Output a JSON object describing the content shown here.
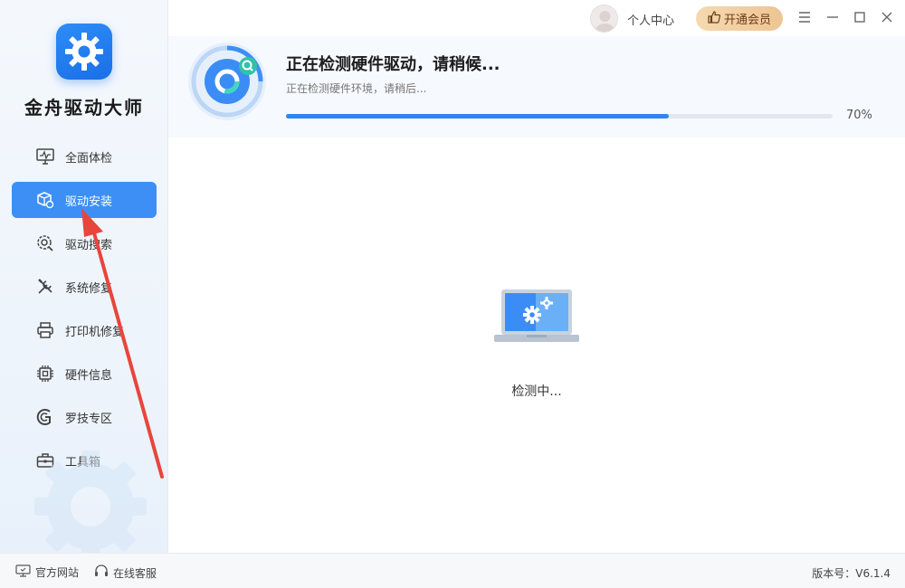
{
  "app": {
    "name": "金舟驱动大师"
  },
  "sidebar": {
    "items": [
      {
        "label": "全面体检",
        "icon": "monitor-check-icon",
        "active": false
      },
      {
        "label": "驱动安装",
        "icon": "package-gear-icon",
        "active": true
      },
      {
        "label": "驱动搜索",
        "icon": "search-gear-icon",
        "active": false
      },
      {
        "label": "系统修复",
        "icon": "wrench-screwdriver-icon",
        "active": false
      },
      {
        "label": "打印机修复",
        "icon": "printer-icon",
        "active": false
      },
      {
        "label": "硬件信息",
        "icon": "chip-icon",
        "active": false
      },
      {
        "label": "罗技专区",
        "icon": "logitech-icon",
        "active": false
      },
      {
        "label": "工具箱",
        "icon": "toolbox-icon",
        "active": false
      }
    ]
  },
  "topbar": {
    "user_center": "个人中心",
    "vip_label": "开通会员"
  },
  "scan": {
    "title": "正在检测硬件驱动，请稍候...",
    "subtitle": "正在检测硬件环境，请稍后...",
    "progress": 0.7,
    "progress_label": "70%"
  },
  "main": {
    "status": "检测中..."
  },
  "footer": {
    "website": "官方网站",
    "support": "在线客服",
    "version": "版本号：V6.1.4"
  },
  "colors": {
    "accent": "#3d8ff5",
    "progress": "#2f86f2",
    "vip_bg": "#eec594",
    "annotation": "#e8453c"
  }
}
